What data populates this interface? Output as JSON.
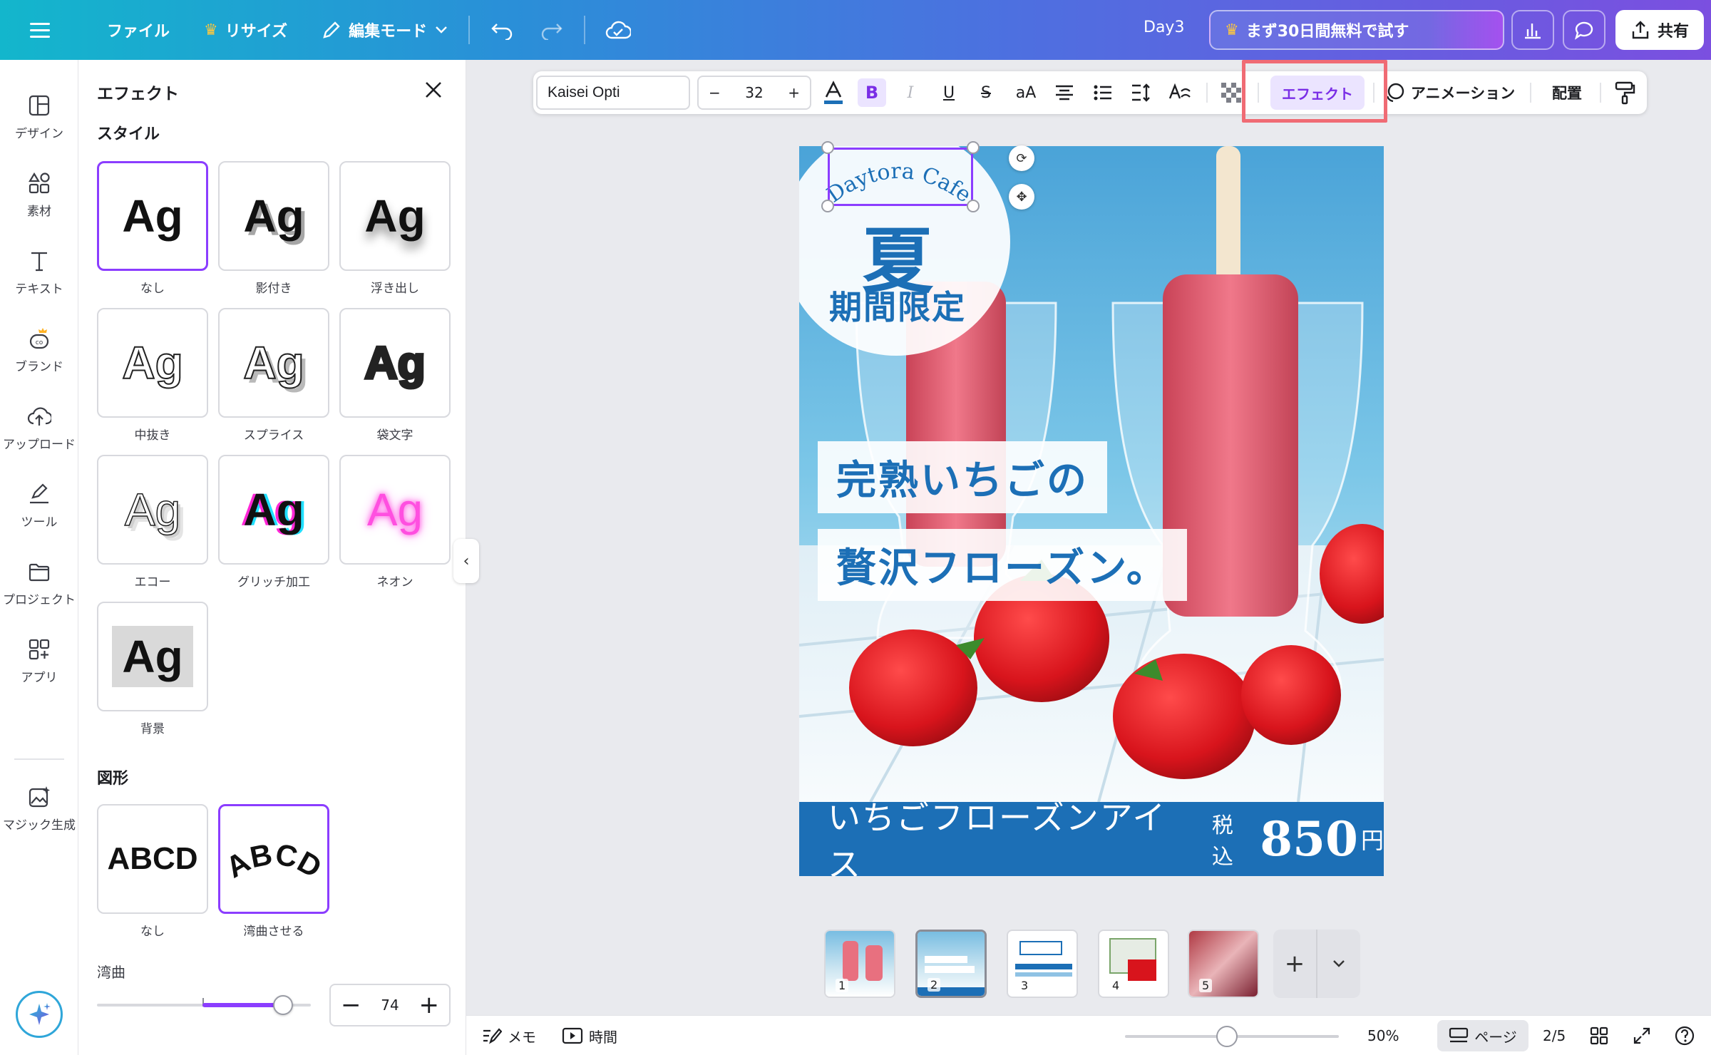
{
  "topbar": {
    "file_label": "ファイル",
    "resize_label": "リサイズ",
    "edit_mode_label": "編集モード",
    "doc_name": "Day3",
    "trial_label": "まず30日間無料で試す",
    "share_label": "共有"
  },
  "rail": {
    "items": [
      {
        "label": "デザイン",
        "icon": "layout-icon"
      },
      {
        "label": "素材",
        "icon": "elements-icon"
      },
      {
        "label": "テキスト",
        "icon": "text-icon"
      },
      {
        "label": "ブランド",
        "icon": "brand-icon"
      },
      {
        "label": "アップロード",
        "icon": "upload-icon"
      },
      {
        "label": "ツール",
        "icon": "draw-icon"
      },
      {
        "label": "プロジェクト",
        "icon": "folder-icon"
      },
      {
        "label": "アプリ",
        "icon": "apps-icon"
      },
      {
        "label": "マジック生成",
        "icon": "magic-media-icon"
      }
    ]
  },
  "panel": {
    "title": "エフェクト",
    "style_section": "スタイル",
    "sample_text": "Ag",
    "styles": [
      {
        "label": "なし",
        "selected": true
      },
      {
        "label": "影付き"
      },
      {
        "label": "浮き出し"
      },
      {
        "label": "中抜き"
      },
      {
        "label": "スプライス"
      },
      {
        "label": "袋文字"
      },
      {
        "label": "エコー"
      },
      {
        "label": "グリッチ加工"
      },
      {
        "label": "ネオン"
      },
      {
        "label": "背景"
      }
    ],
    "shape_section": "図形",
    "shape_sample": "ABCD",
    "shapes": [
      {
        "label": "なし"
      },
      {
        "label": "湾曲させる",
        "selected": true
      }
    ],
    "curve_label": "湾曲",
    "curve_value": "74",
    "curve_slider_level": 0.74
  },
  "toolbar": {
    "font_name": "Kaisei Opti",
    "font_size": "32",
    "aa_label": "aA",
    "effect_label": "エフェクト",
    "animation_label": "アニメーション",
    "position_label": "配置"
  },
  "poster": {
    "cafe_name": "Daytora Cafe",
    "season": "夏",
    "limited": "期間限定",
    "headline1": "完熟いちごの",
    "headline2": "贅沢フローズン。",
    "product": "いちごフローズンアイス",
    "tax_label": "税込",
    "price": "850",
    "currency": "円"
  },
  "pages": {
    "thumbnails": [
      "1",
      "2",
      "3",
      "4",
      "5"
    ],
    "current_index": 2,
    "indicator": "2/5"
  },
  "bottombar": {
    "notes_label": "メモ",
    "timer_label": "時間",
    "zoom": "50%",
    "page_view_label": "ページ",
    "zoom_level": 0.5
  },
  "colors": {
    "accent": "#8b3dff",
    "brand_blue": "#1c6fb6",
    "highlight_red": "#f06b74"
  }
}
